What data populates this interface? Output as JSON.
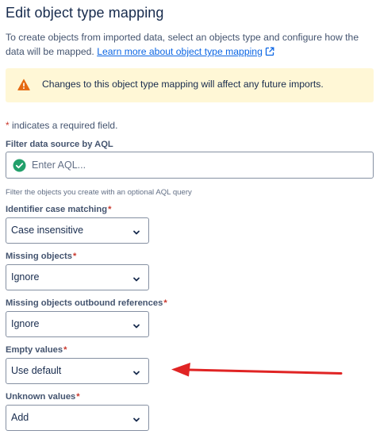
{
  "title": "Edit object type mapping",
  "description": {
    "text": "To create objects from imported data, select an objects type and configure how the data will be mapped.",
    "link": "Learn more about object type mapping",
    "link_icon": "external-link-icon"
  },
  "warning": {
    "icon": "warning-triangle-icon",
    "text": "Changes to this object type mapping will affect any future imports.",
    "color": "#fff7d6"
  },
  "required_note": {
    "star": "*",
    "text": "indicates a required field."
  },
  "aql_filter": {
    "label": "Filter data source by AQL",
    "placeholder": "Enter AQL...",
    "icon": "check-circle-icon",
    "helper": "Filter the objects you create with an optional AQL query"
  },
  "fields": [
    {
      "label": "Identifier case matching",
      "required": "*",
      "value": "Case insensitive"
    },
    {
      "label": "Missing objects",
      "required": "*",
      "value": "Ignore"
    },
    {
      "label": "Missing objects outbound references",
      "required": "*",
      "value": "Ignore"
    },
    {
      "label": "Empty values",
      "required": "*",
      "value": "Use default"
    },
    {
      "label": "Unknown values",
      "required": "*",
      "value": "Add"
    }
  ],
  "colors": {
    "accent_link": "#0c66e4",
    "required_star": "#c9372c",
    "success": "#22a06b",
    "warning_icon": "#e56910",
    "annotation_arrow": "#e02424"
  }
}
